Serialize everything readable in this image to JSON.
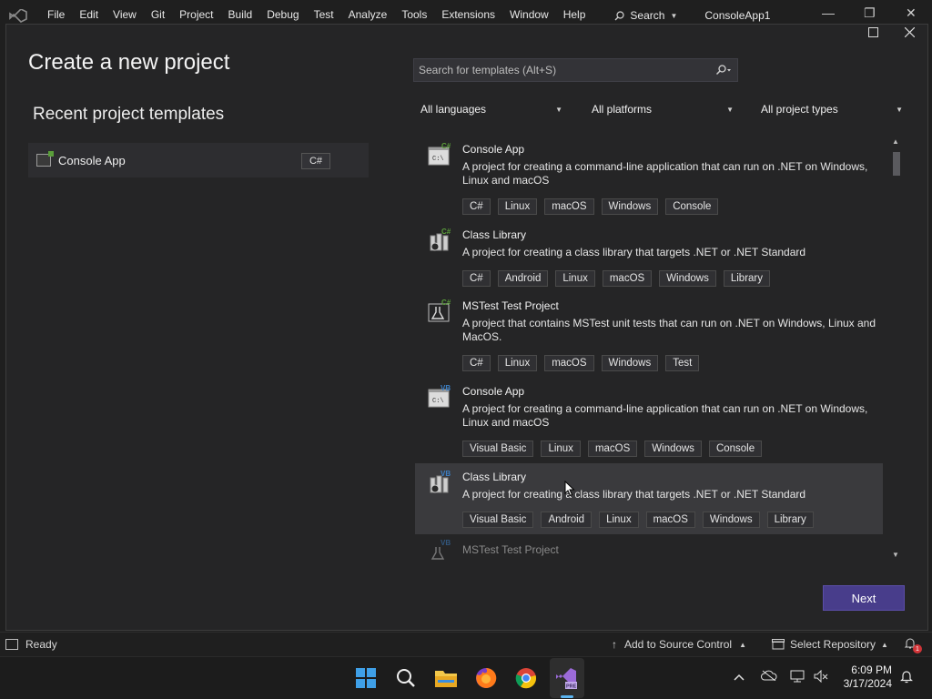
{
  "menubar": {
    "items": [
      "File",
      "Edit",
      "View",
      "Git",
      "Project",
      "Build",
      "Debug",
      "Test",
      "Analyze",
      "Tools",
      "Extensions",
      "Window",
      "Help"
    ],
    "search_label": "Search",
    "app_title": "ConsoleApp1"
  },
  "dialog": {
    "title": "Create a new project",
    "recent_title": "Recent project templates",
    "recent": [
      {
        "label": "Console App",
        "tag": "C#"
      }
    ],
    "search_placeholder": "Search for templates (Alt+S)",
    "filters": {
      "language": "All languages",
      "platform": "All platforms",
      "project_type": "All project types"
    },
    "templates": [
      {
        "name": "Console App",
        "lang_badge": "C#",
        "desc": "A project for creating a command-line application that can run on .NET on Windows, Linux and macOS",
        "tags": [
          "C#",
          "Linux",
          "macOS",
          "Windows",
          "Console"
        ]
      },
      {
        "name": "Class Library",
        "lang_badge": "C#",
        "desc": "A project for creating a class library that targets .NET or .NET Standard",
        "tags": [
          "C#",
          "Android",
          "Linux",
          "macOS",
          "Windows",
          "Library"
        ]
      },
      {
        "name": "MSTest Test Project",
        "lang_badge": "C#",
        "desc": "A project that contains MSTest unit tests that can run on .NET on Windows, Linux and MacOS.",
        "tags": [
          "C#",
          "Linux",
          "macOS",
          "Windows",
          "Test"
        ]
      },
      {
        "name": "Console App",
        "lang_badge": "VB",
        "desc": "A project for creating a command-line application that can run on .NET on Windows, Linux and macOS",
        "tags": [
          "Visual Basic",
          "Linux",
          "macOS",
          "Windows",
          "Console"
        ]
      },
      {
        "name": "Class Library",
        "lang_badge": "VB",
        "desc": "A project for creating a class library that targets .NET or .NET Standard",
        "tags": [
          "Visual Basic",
          "Android",
          "Linux",
          "macOS",
          "Windows",
          "Library"
        ]
      },
      {
        "name": "MSTest Test Project",
        "lang_badge": "VB",
        "desc": "",
        "tags": []
      }
    ],
    "next_label": "Next"
  },
  "statusbar": {
    "ready": "Ready",
    "source_control": "Add to Source Control",
    "repository": "Select Repository",
    "notification_count": "1"
  },
  "taskbar": {
    "time": "6:09 PM",
    "date": "3/17/2024",
    "vs_badge": "PRE"
  },
  "colors": {
    "accent": "#483d8b",
    "background": "#1f1f1f",
    "panel": "#252526",
    "selected_row": "#3a3a3d",
    "csharp_green": "#5a9e3a",
    "vb_blue": "#3c7fc4"
  }
}
